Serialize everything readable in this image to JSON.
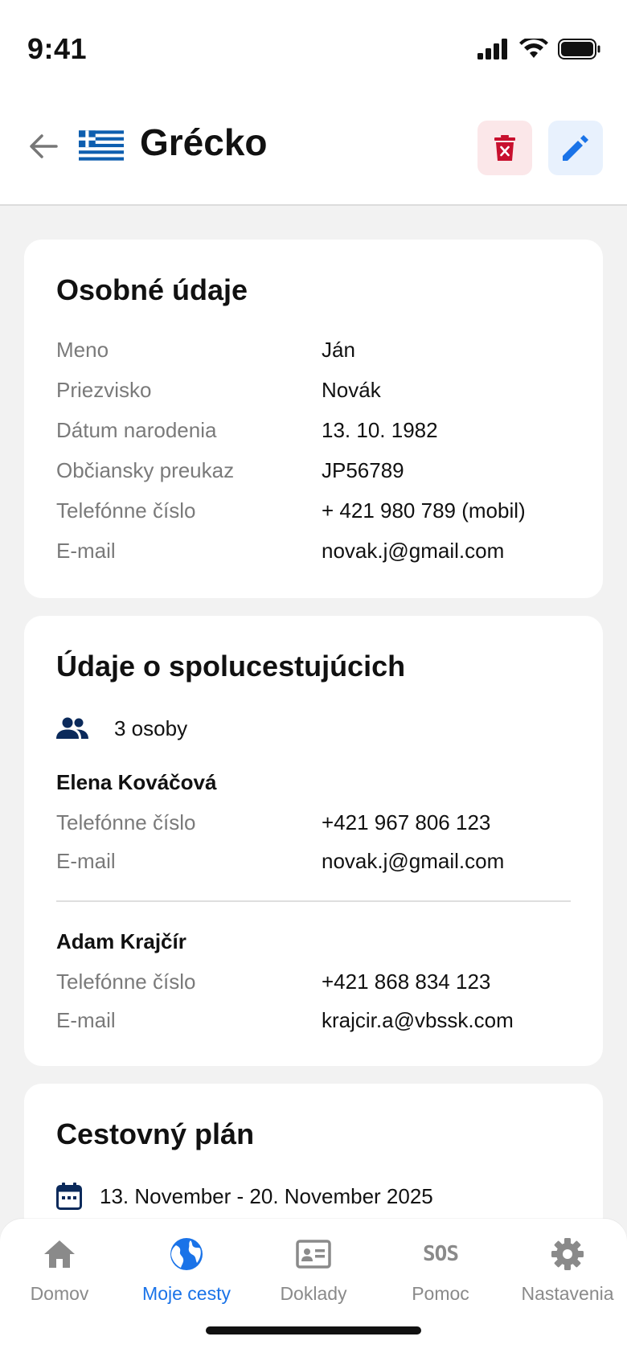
{
  "status_bar": {
    "time": "9:41"
  },
  "header": {
    "title": "Grécko"
  },
  "personal": {
    "title": "Osobné údaje",
    "rows": [
      {
        "label": "Meno",
        "value": "Ján"
      },
      {
        "label": "Priezvisko",
        "value": "Novák"
      },
      {
        "label": "Dátum narodenia",
        "value": "13. 10. 1982"
      },
      {
        "label": "Občiansky preukaz",
        "value": "JP56789"
      },
      {
        "label": "Telefónne číslo",
        "value": "+ 421 980 789 (mobil)"
      },
      {
        "label": "E-mail",
        "value": "novak.j@gmail.com"
      }
    ]
  },
  "companions": {
    "title": "Údaje o spolucestujúcich",
    "count": "3 osoby",
    "people": [
      {
        "name": "Elena Kováčová",
        "rows": [
          {
            "label": "Telefónne číslo",
            "value": "+421 967 806 123"
          },
          {
            "label": "E-mail",
            "value": "novak.j@gmail.com"
          }
        ]
      },
      {
        "name": "Adam Krajčír",
        "rows": [
          {
            "label": "Telefónne číslo",
            "value": "+421 868 834 123"
          },
          {
            "label": "E-mail",
            "value": "krajcir.a@vbssk.com"
          }
        ]
      }
    ]
  },
  "itinerary": {
    "title": "Cestovný plán",
    "dates": "13. November - 20. November 2025"
  },
  "nav": {
    "items": [
      {
        "label": "Domov",
        "icon": "home-icon"
      },
      {
        "label": "Moje cesty",
        "icon": "globe-icon",
        "active": true
      },
      {
        "label": "Doklady",
        "icon": "id-card-icon"
      },
      {
        "label": "Pomoc",
        "icon": "sos-icon",
        "icon_text": "SOS"
      },
      {
        "label": "Nastavenia",
        "icon": "gear-icon"
      }
    ]
  },
  "colors": {
    "accent": "#1a73e8",
    "danger": "#c8102e",
    "danger_bg": "#fbe7e9",
    "edit_bg": "#e8f1fd",
    "flag_blue": "#0d5eaf",
    "navy_icon": "#0b2a5b"
  }
}
